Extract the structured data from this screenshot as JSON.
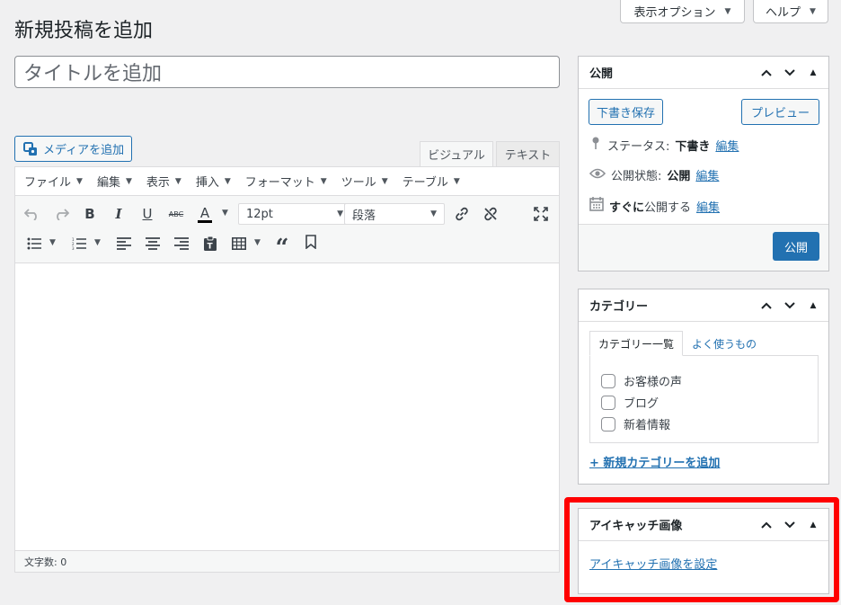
{
  "screen_options": {
    "display_options_label": "表示オプション",
    "help_label": "ヘルプ"
  },
  "page_title": "新規投稿を追加",
  "title_field": {
    "placeholder": "タイトルを追加",
    "value": ""
  },
  "media_button_label": "メディアを追加",
  "editor_tabs": [
    {
      "label": "ビジュアル",
      "active": true
    },
    {
      "label": "テキスト",
      "active": false
    }
  ],
  "menubar": [
    {
      "label": "ファイル"
    },
    {
      "label": "編集"
    },
    {
      "label": "表示"
    },
    {
      "label": "挿入"
    },
    {
      "label": "フォーマット"
    },
    {
      "label": "ツール"
    },
    {
      "label": "テーブル"
    }
  ],
  "toolbar": {
    "font_size": "12pt",
    "format": "段落",
    "bold_glyph": "B",
    "italic_glyph": "I",
    "underline_glyph": "U",
    "strike_glyph": "ABC",
    "color_glyph": "A",
    "quote_glyph": "“"
  },
  "status_bar": {
    "word_count": "文字数: 0"
  },
  "publish_box": {
    "title": "公開",
    "save_draft": "下書き保存",
    "preview": "プレビュー",
    "status_label": "ステータス:",
    "status_value": "下書き",
    "visibility_label": "公開状態:",
    "visibility_value": "公開",
    "schedule_value": "すぐに",
    "schedule_label": "公開する",
    "edit_link": "編集",
    "publish_button": "公開"
  },
  "category_box": {
    "title": "カテゴリー",
    "tab_all": "カテゴリー一覧",
    "tab_popular": "よく使うもの",
    "items": [
      {
        "label": "お客様の声",
        "checked": false
      },
      {
        "label": "ブログ",
        "checked": false
      },
      {
        "label": "新着情報",
        "checked": false
      }
    ],
    "add_new": "+ 新規カテゴリーを追加"
  },
  "featured_image_box": {
    "title": "アイキャッチ画像",
    "set_link": "アイキャッチ画像を設定"
  },
  "colors": {
    "accent": "#2271b1",
    "highlight": "#ff0000",
    "background": "#f0f0f1"
  }
}
